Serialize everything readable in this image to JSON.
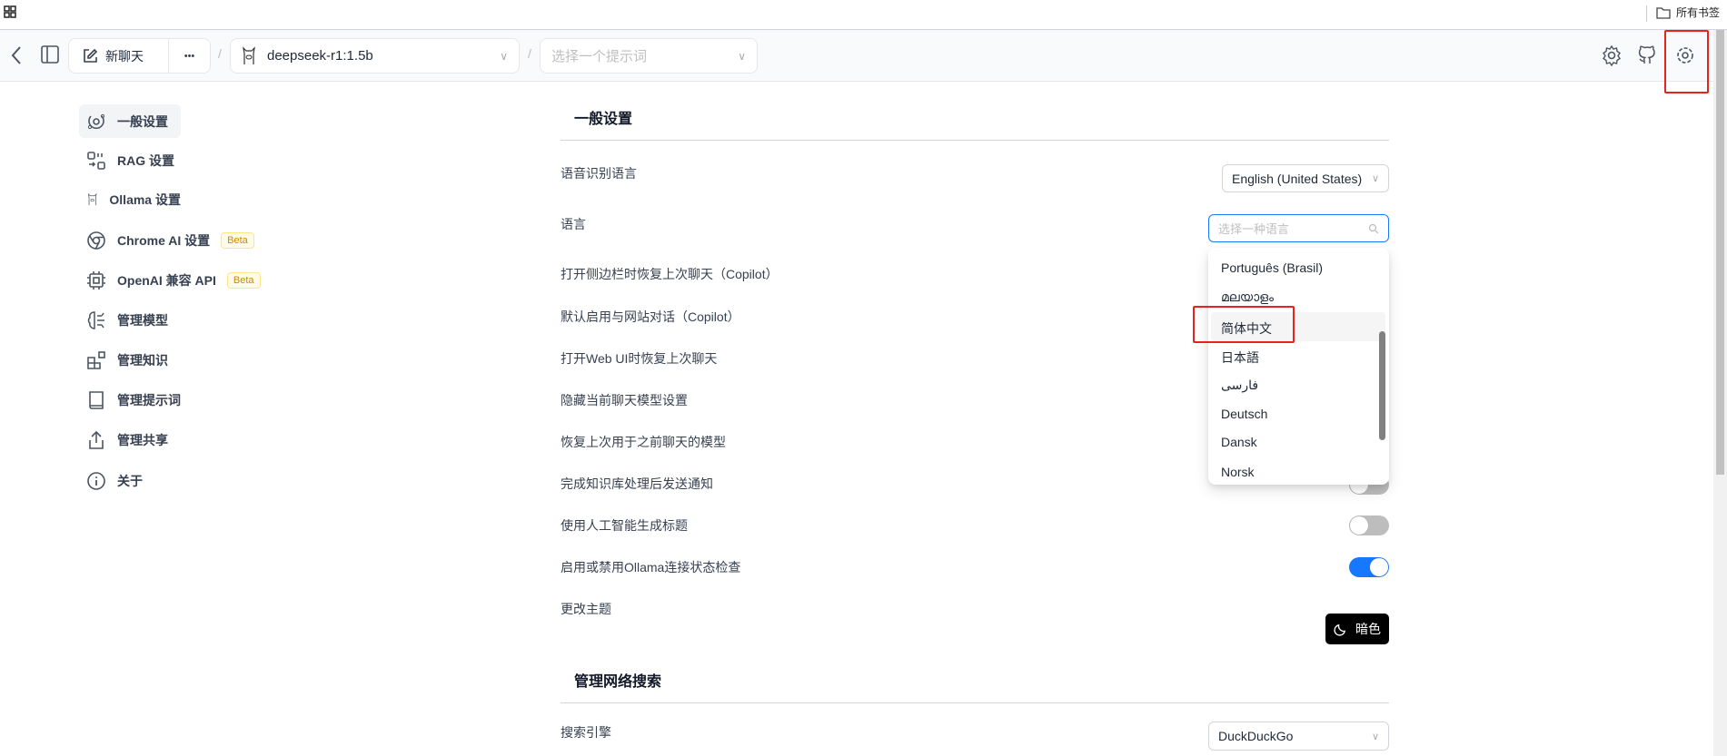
{
  "browser": {
    "bookmarks_label": "所有书签"
  },
  "header": {
    "new_chat": "新聊天",
    "more": "•••",
    "separator": "/",
    "model": "deepseek-r1:1.5b",
    "prompt_placeholder": "选择一个提示词"
  },
  "sidebar": {
    "items": [
      {
        "label": "一般设置",
        "icon": "settings-orbit-icon",
        "active": true
      },
      {
        "label": "RAG 设置",
        "icon": "rag-icon"
      },
      {
        "label": "Ollama 设置",
        "icon": "llama-icon"
      },
      {
        "label": "Chrome AI 设置",
        "icon": "chrome-icon",
        "badge": "Beta"
      },
      {
        "label": "OpenAI 兼容 API",
        "icon": "chip-icon",
        "badge": "Beta"
      },
      {
        "label": "管理模型",
        "icon": "brain-icon"
      },
      {
        "label": "管理知识",
        "icon": "blocks-icon"
      },
      {
        "label": "管理提示词",
        "icon": "book-icon"
      },
      {
        "label": "管理共享",
        "icon": "share-icon"
      },
      {
        "label": "关于",
        "icon": "info-icon"
      }
    ]
  },
  "general": {
    "title": "一般设置",
    "speech_label": "语音识别语言",
    "speech_value": "English (United States)",
    "language_label": "语言",
    "language_placeholder": "选择一种语言",
    "rows": [
      {
        "label": "打开侧边栏时恢复上次聊天（Copilot）",
        "on": false
      },
      {
        "label": "默认启用与网站对话（Copilot）",
        "on": false
      },
      {
        "label": "打开Web UI时恢复上次聊天",
        "on": false
      },
      {
        "label": "隐藏当前聊天模型设置",
        "on": false
      },
      {
        "label": "恢复上次用于之前聊天的模型",
        "on": false
      },
      {
        "label": "完成知识库处理后发送通知",
        "on": false
      },
      {
        "label": "使用人工智能生成标题",
        "on": false
      },
      {
        "label": "启用或禁用Ollama连接状态检查",
        "on": true
      }
    ],
    "theme_label": "更改主题",
    "theme_button": "暗色"
  },
  "language_options": [
    "Português (Brasil)",
    "മലയാളം",
    "简体中文",
    "日本語",
    "فارسی",
    "Deutsch",
    "Dansk",
    "Norsk"
  ],
  "highlighted_option": "简体中文",
  "web_search": {
    "title": "管理网络搜索",
    "engine_label": "搜索引擎",
    "engine_value": "DuckDuckGo"
  },
  "colors": {
    "accent": "#1677ff",
    "highlight_box": "#e8231b",
    "beta": "#ca8a04"
  }
}
